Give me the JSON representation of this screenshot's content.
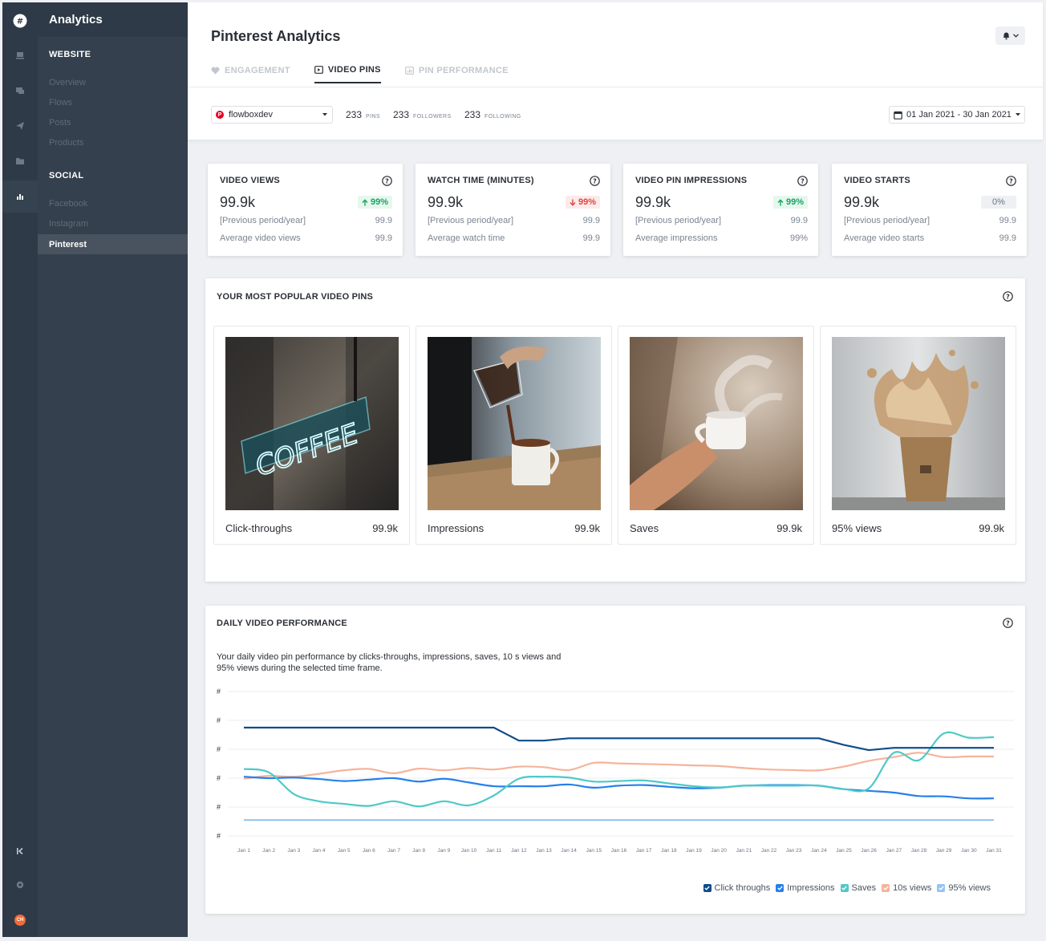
{
  "app": {
    "title": "Analytics",
    "logo_icon": "hash-chat-icon",
    "user_initials": "CH"
  },
  "sidebar": {
    "sections": [
      {
        "label": "WEBSITE",
        "items": [
          "Overview",
          "Flows",
          "Posts",
          "Products"
        ]
      },
      {
        "label": "SOCIAL",
        "items": [
          "Facebook",
          "Instagram",
          "Pinterest"
        ]
      }
    ],
    "active_item": "Pinterest"
  },
  "header": {
    "title": "Pinterest Analytics",
    "tabs": [
      {
        "label": "ENGAGEMENT",
        "icon": "heart-icon",
        "active": false
      },
      {
        "label": "VIDEO PINS",
        "icon": "play-icon",
        "active": true
      },
      {
        "label": "PIN PERFORMANCE",
        "icon": "chart-card-icon",
        "active": false
      }
    ],
    "account": "flowboxdev",
    "stats": [
      {
        "value": "233",
        "label": "PINS"
      },
      {
        "value": "233",
        "label": "FOLLOWERS"
      },
      {
        "value": "233",
        "label": "FOLLOWING"
      }
    ],
    "date_range": "01 Jan 2021 - 30 Jan 2021"
  },
  "kpis": [
    {
      "title": "VIDEO VIEWS",
      "value": "99.9k",
      "change": "99%",
      "trend": "up",
      "row1_label": "[Previous period/year]",
      "row1_value": "99.9",
      "row2_label": "Average video views",
      "row2_value": "99.9"
    },
    {
      "title": "WATCH TIME (MINUTES)",
      "value": "99.9k",
      "change": "99%",
      "trend": "down",
      "row1_label": "[Previous period/year]",
      "row1_value": "99.9",
      "row2_label": "Average watch time",
      "row2_value": "99.9"
    },
    {
      "title": "VIDEO PIN IMPRESSIONS",
      "value": "99.9k",
      "change": "99%",
      "trend": "up",
      "row1_label": "[Previous period/year]",
      "row1_value": "99.9",
      "row2_label": "Average impressions",
      "row2_value": "99%"
    },
    {
      "title": "VIDEO STARTS",
      "value": "99.9k",
      "change": "0%",
      "trend": "flat",
      "row1_label": "[Previous period/year]",
      "row1_value": "99.9",
      "row2_label": "Average video starts",
      "row2_value": "99.9"
    }
  ],
  "popular": {
    "title": "YOUR MOST POPULAR VIDEO PINS",
    "pins": [
      {
        "label": "Click-throughs",
        "value": "99.9k",
        "image": "coffee-neon-sign"
      },
      {
        "label": "Impressions",
        "value": "99.9k",
        "image": "pour-over-coffee"
      },
      {
        "label": "Saves",
        "value": "99.9k",
        "image": "steaming-cup-hand"
      },
      {
        "label": "95% views",
        "value": "99.9k",
        "image": "coffee-splash-cup"
      }
    ]
  },
  "daily": {
    "title": "DAILY VIDEO PERFORMANCE",
    "description": "Your daily video pin performance by clicks-throughs, impressions, saves, 10 s views and 95% views during the selected time frame."
  },
  "chart_data": {
    "type": "line",
    "x": [
      "Jan 1",
      "Jan 2",
      "Jan 3",
      "Jan 4",
      "Jan 5",
      "Jan 6",
      "Jan 7",
      "Jan 8",
      "Jan 9",
      "Jan 10",
      "Jan 11",
      "Jan 12",
      "Jan 13",
      "Jan 14",
      "Jan 15",
      "Jan 16",
      "Jan 17",
      "Jan 18",
      "Jan 19",
      "Jan 20",
      "Jan 21",
      "Jan 22",
      "Jan 23",
      "Jan 24",
      "Jan 25",
      "Jan 26",
      "Jan 27",
      "Jan 28",
      "Jan 29",
      "Jan 30",
      "Jan 31"
    ],
    "y_ticks": [
      "#",
      "#",
      "#",
      "#",
      "#",
      "#"
    ],
    "ylim": [
      0,
      5
    ],
    "grid": true,
    "legend": "bottom-right",
    "series": [
      {
        "name": "Click throughs",
        "color": "#0f4c8a",
        "values": [
          3.75,
          3.75,
          3.75,
          3.75,
          3.75,
          3.75,
          3.75,
          3.75,
          3.75,
          3.75,
          3.75,
          3.3,
          3.3,
          3.38,
          3.38,
          3.38,
          3.38,
          3.38,
          3.38,
          3.38,
          3.38,
          3.38,
          3.38,
          3.38,
          3.15,
          2.97,
          3.05,
          3.05,
          3.05,
          3.05,
          3.05
        ]
      },
      {
        "name": "Impressions",
        "color": "#2680eb",
        "values": [
          2.05,
          2.0,
          2.02,
          1.97,
          1.9,
          1.95,
          2.0,
          1.88,
          1.98,
          1.85,
          1.72,
          1.72,
          1.72,
          1.78,
          1.67,
          1.74,
          1.76,
          1.7,
          1.65,
          1.67,
          1.74,
          1.76,
          1.76,
          1.74,
          1.62,
          1.56,
          1.5,
          1.38,
          1.37,
          1.3,
          1.3
        ]
      },
      {
        "name": "Saves",
        "color": "#4ec9c8",
        "values": [
          2.32,
          2.2,
          1.45,
          1.2,
          1.11,
          1.04,
          1.2,
          1.02,
          1.2,
          1.06,
          1.4,
          1.98,
          2.05,
          2.02,
          1.88,
          1.9,
          1.92,
          1.82,
          1.72,
          1.68,
          1.74,
          1.74,
          1.74,
          1.74,
          1.62,
          1.65,
          2.88,
          2.62,
          3.55,
          3.4,
          3.42
        ]
      },
      {
        "name": "10s views",
        "color": "#f5b49b",
        "values": [
          1.98,
          2.08,
          2.05,
          2.15,
          2.27,
          2.32,
          2.17,
          2.33,
          2.27,
          2.35,
          2.3,
          2.4,
          2.38,
          2.28,
          2.53,
          2.51,
          2.49,
          2.47,
          2.44,
          2.42,
          2.35,
          2.3,
          2.28,
          2.27,
          2.4,
          2.6,
          2.73,
          2.88,
          2.73,
          2.75,
          2.75
        ]
      },
      {
        "name": "95% views",
        "color": "#94c4f4",
        "values": [
          0.55,
          0.55,
          0.55,
          0.55,
          0.55,
          0.55,
          0.55,
          0.55,
          0.55,
          0.55,
          0.55,
          0.55,
          0.55,
          0.55,
          0.55,
          0.55,
          0.55,
          0.55,
          0.55,
          0.55,
          0.55,
          0.55,
          0.55,
          0.55,
          0.55,
          0.55,
          0.55,
          0.55,
          0.55,
          0.55,
          0.55
        ]
      }
    ]
  }
}
